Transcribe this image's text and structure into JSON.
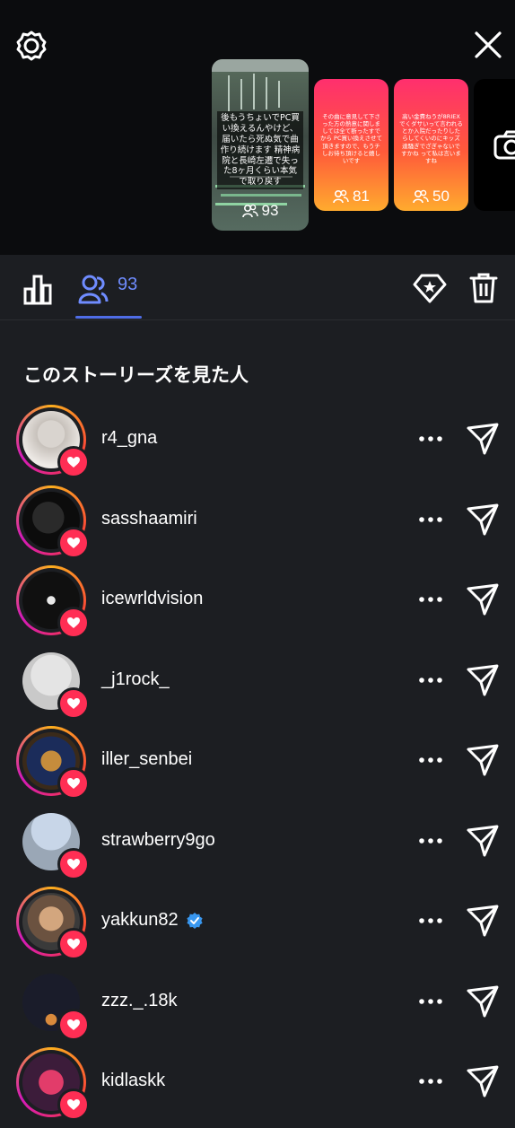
{
  "stories": [
    {
      "caption": "後もうちょいでPC買い換えるんやけど、届いたら死ぬ気で曲作り続けます 精神病院と長崎左遷で失った8ヶ月くらい本気で取り戻す",
      "viewers": "93"
    },
    {
      "caption": "その曲に意見して下さった方の熱意に関しましては全て断ったすでから PC買い換えさせて頂きますので、もうチしお待ち頂けると嬉しいです",
      "viewers": "81"
    },
    {
      "caption": "高い金費ねうが8RIEXでくダサいって言われるとか入院だったりしたらしてくいのにキッズ達騒ぎでざぎゃないですかね って私は言いますね",
      "viewers": "50"
    }
  ],
  "tabs": {
    "viewers_count": "93"
  },
  "section_title": "このストーリーズを見た人",
  "viewers": [
    {
      "username": "r4_gna",
      "verified": false,
      "ring": true
    },
    {
      "username": "sasshaamiri",
      "verified": false,
      "ring": true
    },
    {
      "username": "icewrldvision",
      "verified": false,
      "ring": true
    },
    {
      "username": "_j1rock_",
      "verified": false,
      "ring": false
    },
    {
      "username": "iller_senbei",
      "verified": false,
      "ring": true
    },
    {
      "username": "strawberry9go",
      "verified": false,
      "ring": false
    },
    {
      "username": "yakkun82",
      "verified": true,
      "ring": true
    },
    {
      "username": "zzz._.18k",
      "verified": false,
      "ring": false
    },
    {
      "username": "kidlaskk",
      "verified": false,
      "ring": true
    }
  ],
  "colors": {
    "accent": "#4f6de6",
    "heart": "#ff2e54",
    "verified": "#3897f0"
  }
}
